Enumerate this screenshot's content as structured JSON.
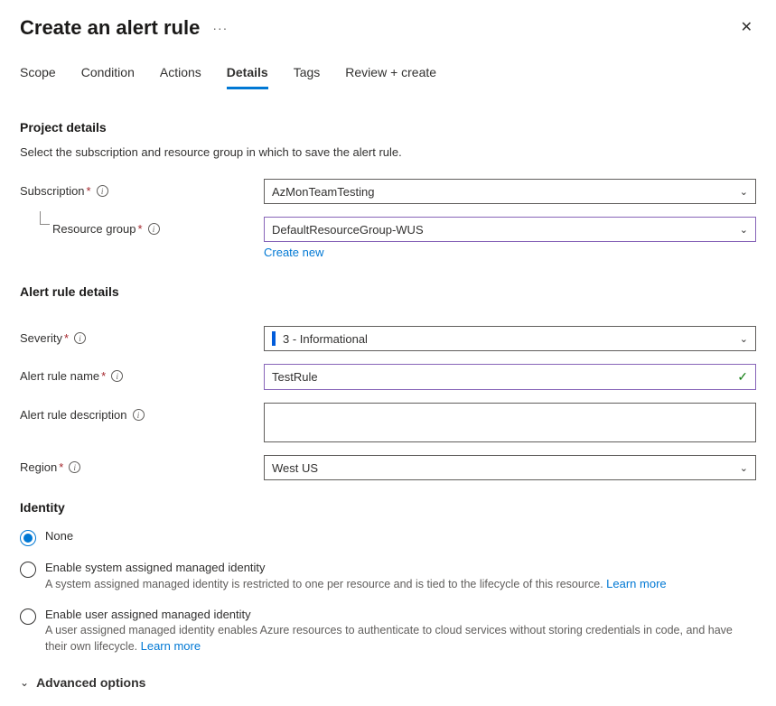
{
  "header": {
    "title": "Create an alert rule",
    "more_icon": "more-icon",
    "close_icon": "close-icon"
  },
  "tabs": [
    {
      "label": "Scope",
      "active": false
    },
    {
      "label": "Condition",
      "active": false
    },
    {
      "label": "Actions",
      "active": false
    },
    {
      "label": "Details",
      "active": true
    },
    {
      "label": "Tags",
      "active": false
    },
    {
      "label": "Review + create",
      "active": false
    }
  ],
  "projectDetails": {
    "heading": "Project details",
    "help": "Select the subscription and resource group in which to save the alert rule.",
    "subscription": {
      "label": "Subscription",
      "value": "AzMonTeamTesting",
      "required": true
    },
    "resourceGroup": {
      "label": "Resource group",
      "value": "DefaultResourceGroup-WUS",
      "required": true,
      "createNew": "Create new"
    }
  },
  "alertRuleDetails": {
    "heading": "Alert rule details",
    "severity": {
      "label": "Severity",
      "value": "3 - Informational",
      "required": true
    },
    "name": {
      "label": "Alert rule name",
      "value": "TestRule",
      "required": true
    },
    "description": {
      "label": "Alert rule description",
      "value": "",
      "required": false
    },
    "region": {
      "label": "Region",
      "value": "West US",
      "required": true
    }
  },
  "identity": {
    "heading": "Identity",
    "options": [
      {
        "label": "None",
        "selected": true,
        "desc": "",
        "learnMore": ""
      },
      {
        "label": "Enable system assigned managed identity",
        "selected": false,
        "desc": "A system assigned managed identity is restricted to one per resource and is tied to the lifecycle of this resource. ",
        "learnMore": "Learn more"
      },
      {
        "label": "Enable user assigned managed identity",
        "selected": false,
        "desc": "A user assigned managed identity enables Azure resources to authenticate to cloud services without storing credentials in code, and have their own lifecycle. ",
        "learnMore": "Learn more"
      }
    ]
  },
  "advanced": {
    "label": "Advanced options"
  }
}
